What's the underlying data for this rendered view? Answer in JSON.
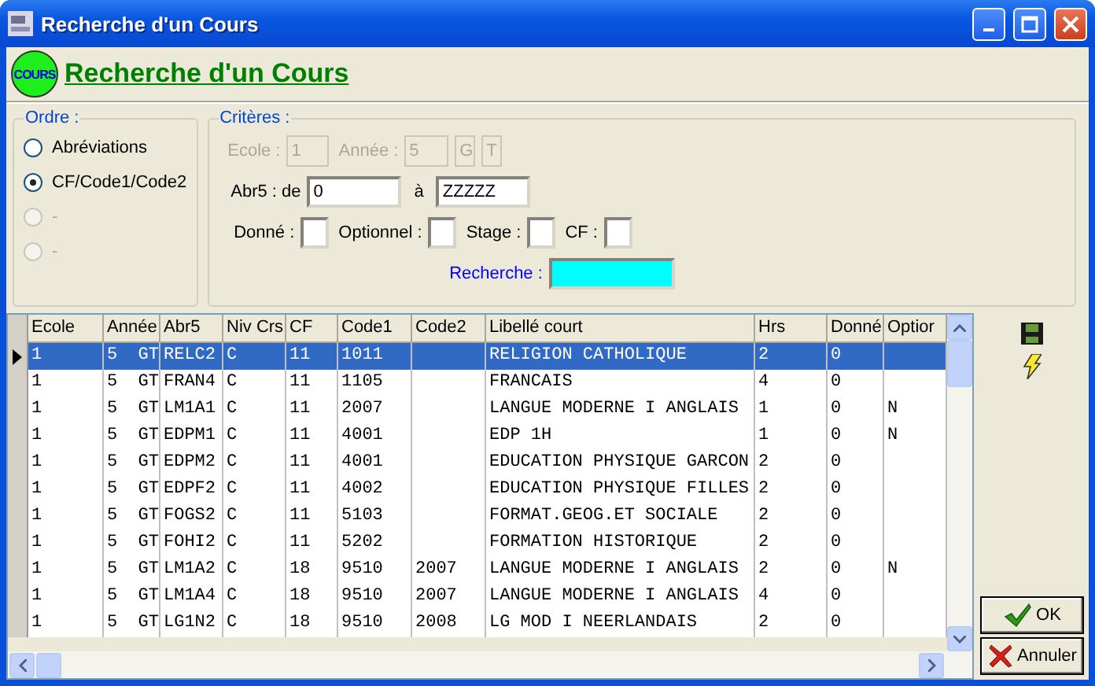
{
  "window": {
    "title": "Recherche d'un Cours"
  },
  "header": {
    "logo": "COURS",
    "title": "Recherche d'un Cours"
  },
  "ordre": {
    "legend": "Ordre :",
    "options": [
      {
        "label": "Abréviations",
        "selected": false,
        "disabled": false
      },
      {
        "label": "CF/Code1/Code2",
        "selected": true,
        "disabled": false
      },
      {
        "label": "-",
        "selected": false,
        "disabled": true
      },
      {
        "label": "-",
        "selected": false,
        "disabled": true
      }
    ]
  },
  "criteres": {
    "legend": "Critères :",
    "ecole": {
      "label": "Ecole :",
      "value": "1",
      "disabled": true
    },
    "annee": {
      "label": "Année :",
      "values": [
        "5",
        "G",
        "T"
      ],
      "disabled": true
    },
    "abr5": {
      "label": "Abr5 : de",
      "from": "0",
      "to_label": "à",
      "to": "ZZZZZ"
    },
    "flags": [
      {
        "label": "Donné :"
      },
      {
        "label": "Optionnel :"
      },
      {
        "label": "Stage :"
      },
      {
        "label": "CF :"
      }
    ],
    "recherche": {
      "label": "Recherche :"
    }
  },
  "table": {
    "columns": [
      "Ecole",
      "Année",
      "Abr5",
      "Niv Crs",
      "CF",
      "Code1",
      "Code2",
      "Libellé court",
      "Hrs",
      "Donné",
      "Optior"
    ],
    "rows": [
      {
        "selected": true,
        "cells": [
          "1",
          "5  GT",
          "RELC2",
          "C",
          "11",
          "1011",
          "",
          "RELIGION CATHOLIQUE",
          "2",
          "0",
          ""
        ]
      },
      {
        "selected": false,
        "cells": [
          "1",
          "5  GT",
          "FRAN4",
          "C",
          "11",
          "1105",
          "",
          "FRANCAIS",
          "4",
          "0",
          ""
        ]
      },
      {
        "selected": false,
        "cells": [
          "1",
          "5  GT",
          "LM1A1",
          "C",
          "11",
          "2007",
          "",
          "LANGUE MODERNE I ANGLAIS",
          "1",
          "0",
          "N"
        ]
      },
      {
        "selected": false,
        "cells": [
          "1",
          "5  GT",
          "EDPM1",
          "C",
          "11",
          "4001",
          "",
          "EDP 1H",
          "1",
          "0",
          "N"
        ]
      },
      {
        "selected": false,
        "cells": [
          "1",
          "5  GT",
          "EDPM2",
          "C",
          "11",
          "4001",
          "",
          "EDUCATION PHYSIQUE GARCON",
          "2",
          "0",
          ""
        ]
      },
      {
        "selected": false,
        "cells": [
          "1",
          "5  GT",
          "EDPF2",
          "C",
          "11",
          "4002",
          "",
          "EDUCATION PHYSIQUE FILLES",
          "2",
          "0",
          ""
        ]
      },
      {
        "selected": false,
        "cells": [
          "1",
          "5  GT",
          "FOGS2",
          "C",
          "11",
          "5103",
          "",
          "FORMAT.GEOG.ET SOCIALE",
          "2",
          "0",
          ""
        ]
      },
      {
        "selected": false,
        "cells": [
          "1",
          "5  GT",
          "FOHI2",
          "C",
          "11",
          "5202",
          "",
          "FORMATION HISTORIQUE",
          "2",
          "0",
          ""
        ]
      },
      {
        "selected": false,
        "cells": [
          "1",
          "5  GT",
          "LM1A2",
          "C",
          "18",
          "9510",
          "2007",
          "LANGUE MODERNE I ANGLAIS",
          "2",
          "0",
          "N"
        ]
      },
      {
        "selected": false,
        "cells": [
          "1",
          "5  GT",
          "LM1A4",
          "C",
          "18",
          "9510",
          "2007",
          "LANGUE MODERNE I ANGLAIS",
          "4",
          "0",
          ""
        ]
      },
      {
        "selected": false,
        "cells": [
          "1",
          "5  GT",
          "LG1N2",
          "C",
          "18",
          "9510",
          "2008",
          "LG MOD I NEERLANDAIS",
          "2",
          "0",
          ""
        ]
      }
    ]
  },
  "buttons": [
    {
      "kind": "ok",
      "label": "OK"
    },
    {
      "kind": "cancel",
      "label": "Annuler"
    }
  ]
}
